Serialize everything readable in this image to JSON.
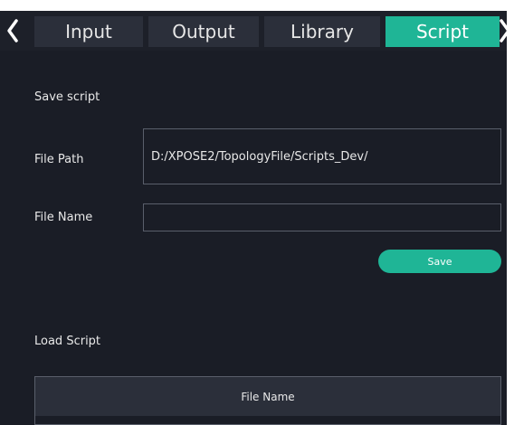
{
  "tabs": [
    {
      "label": "Input",
      "active": false
    },
    {
      "label": "Output",
      "active": false
    },
    {
      "label": "Library",
      "active": false
    },
    {
      "label": "Script",
      "active": true
    }
  ],
  "icons": {
    "left": "chevron-left-icon",
    "right": "chevron-right-icon"
  },
  "colors": {
    "accent": "#1fb596",
    "panel_bg": "#1a1d26",
    "tab_bg": "#2b2f3a",
    "border": "#5a5f6b"
  },
  "save_section": {
    "title": "Save script",
    "file_path_label": "File Path",
    "file_path_value": "D:/XPOSE2/TopologyFile/Scripts_Dev/",
    "file_name_label": "File Name",
    "file_name_value": "",
    "save_label": "Save"
  },
  "load_section": {
    "title": "Load Script",
    "table": {
      "columns": [
        "File Name"
      ],
      "rows": []
    }
  }
}
